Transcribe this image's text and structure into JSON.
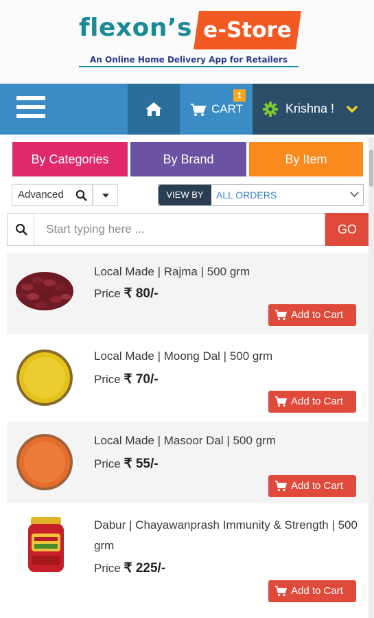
{
  "brand": {
    "name_part1": "flexon’s",
    "name_part2": "e-Store",
    "tagline": "An Online Home Delivery App for Retailers",
    "colors": {
      "teal": "#1b8a97",
      "orange": "#f15a22",
      "navy": "#2d3a8c"
    }
  },
  "navbar": {
    "menu_icon": "hamburger-menu-icon",
    "home_icon": "home-icon",
    "cart_label": "CART",
    "cart_count": "1",
    "user_label": "Krishna !",
    "user_icon": "gear-icon",
    "user_dropdown_icon": "chevron-down-icon"
  },
  "filters": {
    "tabs": [
      {
        "label": "By Categories",
        "color": "#e0296b"
      },
      {
        "label": "By Brand",
        "color": "#6c52a3"
      },
      {
        "label": "By Item",
        "color": "#f98a1d"
      }
    ],
    "advanced_label": "Advanced",
    "view_by_label": "VIEW BY",
    "view_by_value": "ALL ORDERS"
  },
  "search": {
    "placeholder": "Start typing here ...",
    "go_label": "GO"
  },
  "products": [
    {
      "name": "Local Made | Rajma | 500 grm",
      "price_label": "Price",
      "price": "₹ 80/-",
      "button": "Add to Cart",
      "image": "rajma-bowl"
    },
    {
      "name": "Local Made | Moong Dal | 500 grm",
      "price_label": "Price",
      "price": "₹ 70/-",
      "button": "Add to Cart",
      "image": "moong-dal-bowl"
    },
    {
      "name": "Local Made | Masoor Dal | 500 grm",
      "price_label": "Price",
      "price": "₹ 55/-",
      "button": "Add to Cart",
      "image": "masoor-dal-bowl"
    },
    {
      "name": "Dabur | Chayawanprash Immunity & Strength | 500 grm",
      "price_label": "Price",
      "price": "₹ 225/-",
      "button": "Add to Cart",
      "image": "chyawanprash-jar"
    }
  ]
}
